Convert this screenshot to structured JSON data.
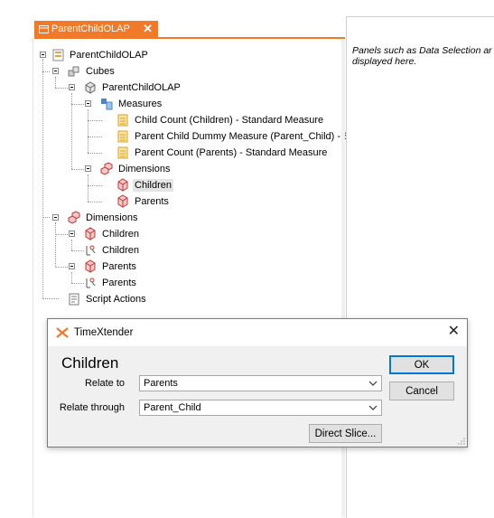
{
  "tab": {
    "label": "ParentChildOLAP",
    "close": "✕"
  },
  "tree": {
    "root": "ParentChildOLAP",
    "cubes": "Cubes",
    "cube_name": "ParentChildOLAP",
    "measures": "Measures",
    "measure_items": [
      "Child Count (Children) - Standard Measure",
      "Parent Child Dummy Measure (Parent_Child) - S",
      "Parent Count (Parents) - Standard Measure"
    ],
    "cube_dimensions": "Dimensions",
    "cube_dimension_items": [
      "Children",
      "Parents"
    ],
    "dimensions": "Dimensions",
    "dim_children": "Children",
    "dim_children_hierarchy": "Children",
    "dim_parents": "Parents",
    "dim_parents_hierarchy": "Parents",
    "script_actions": "Script Actions",
    "selected": "Children"
  },
  "right_panel": {
    "text_line1": "Panels such as Data Selection ar",
    "text_line2": "displayed here."
  },
  "dialog": {
    "title": "TimeXtender",
    "close": "✕",
    "heading": "Children",
    "relate_to_label": "Relate to",
    "relate_to_value": "Parents",
    "relate_through_label": "Relate through",
    "relate_through_value": "Parent_Child",
    "ok_label": "OK",
    "cancel_label": "Cancel",
    "direct_slice_label": "Direct Slice..."
  },
  "colors": {
    "accent": "#f0792a",
    "focus": "#0078d7"
  }
}
